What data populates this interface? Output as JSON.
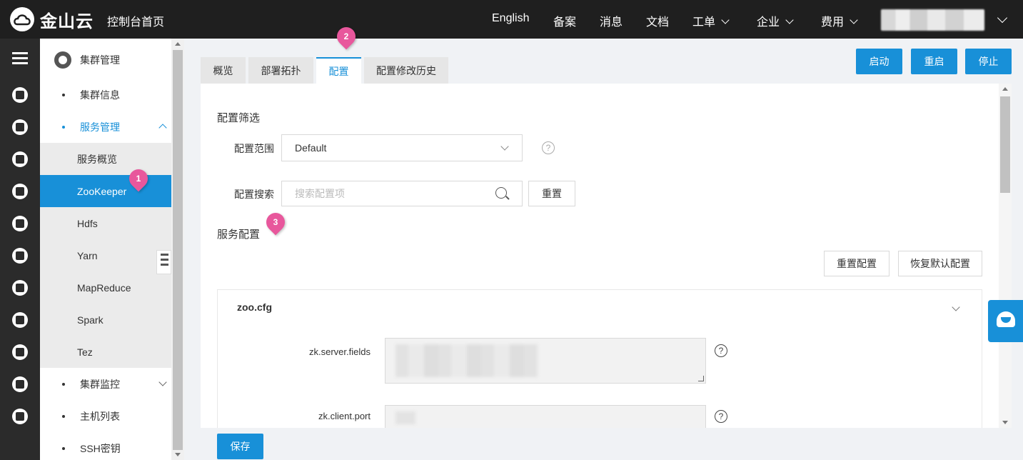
{
  "header": {
    "brand": "金山云",
    "console_home": "控制台首页",
    "nav": [
      {
        "label": "English",
        "dropdown": false
      },
      {
        "label": "备案",
        "dropdown": false
      },
      {
        "label": "消息",
        "dropdown": false
      },
      {
        "label": "文档",
        "dropdown": false
      },
      {
        "label": "工单",
        "dropdown": true
      },
      {
        "label": "企业",
        "dropdown": true
      },
      {
        "label": "费用",
        "dropdown": true
      }
    ]
  },
  "sidebar": {
    "title": "集群管理",
    "items": {
      "cluster_info": "集群信息",
      "service_mgmt": "服务管理",
      "cluster_monitor": "集群监控",
      "host_list": "主机列表",
      "ssh_key": "SSH密钥"
    },
    "services": [
      "服务概览",
      "ZooKeeper",
      "Hdfs",
      "Yarn",
      "MapReduce",
      "Spark",
      "Tez"
    ],
    "selected_service": "ZooKeeper"
  },
  "tabs": [
    "概览",
    "部署拓扑",
    "配置",
    "配置修改历史"
  ],
  "active_tab": "配置",
  "actions": {
    "start": "启动",
    "restart": "重启",
    "stop": "停止"
  },
  "filter": {
    "title": "配置筛选",
    "scope_label": "配置范围",
    "scope_value": "Default",
    "search_label": "配置搜索",
    "search_placeholder": "搜索配置项",
    "reset": "重置"
  },
  "service_config": {
    "title": "服务配置",
    "reset_config": "重置配置",
    "restore_default": "恢复默认配置",
    "file": "zoo.cfg",
    "fields": [
      {
        "key": "zk.server.fields"
      },
      {
        "key": "zk.client.port"
      }
    ]
  },
  "save": "保存",
  "markers": [
    "1",
    "2",
    "3"
  ],
  "colors": {
    "accent": "#1890d8",
    "marker": "#e8579c",
    "topbar": "#1f1f1f"
  }
}
